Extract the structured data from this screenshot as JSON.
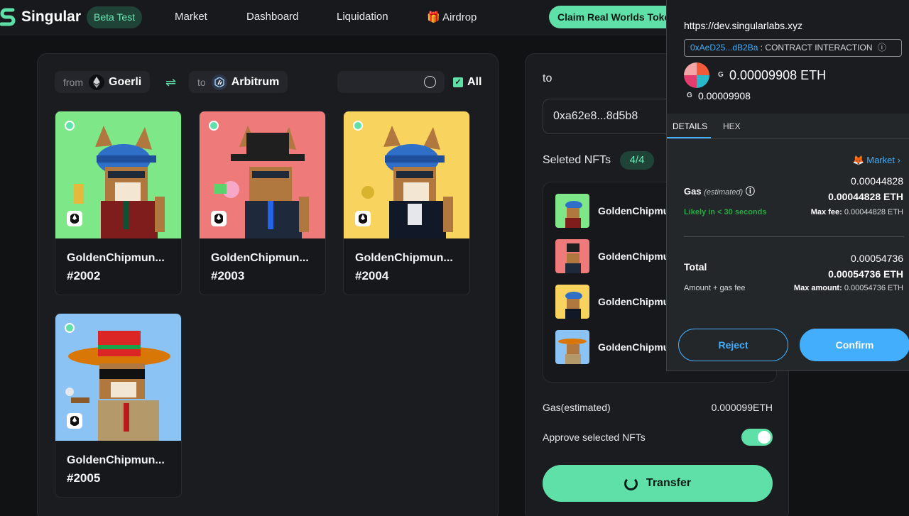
{
  "nav": {
    "brand": "Singular",
    "beta": "Beta Test",
    "links": [
      "Market",
      "Dashboard",
      "Liquidation",
      "Airdrop"
    ],
    "claim": "Claim Real Worlds Token"
  },
  "bridge": {
    "from_label": "from",
    "from_chain": "Goerli",
    "to_label": "to",
    "to_chain": "Arbitrum",
    "all_label": "All"
  },
  "nfts": [
    {
      "name": "GoldenChipmun...",
      "id": "#2002",
      "bg": "#7ee787"
    },
    {
      "name": "GoldenChipmun...",
      "id": "#2003",
      "bg": "#ef7a7a"
    },
    {
      "name": "GoldenChipmun...",
      "id": "#2004",
      "bg": "#f8d35e"
    },
    {
      "name": "GoldenChipmun...",
      "id": "#2005",
      "bg": "#8cc3f5"
    }
  ],
  "transfer": {
    "to_label": "to",
    "to_address": "0xa62e8...8d5b8",
    "selected_label": "Seleted NFTs",
    "selected_count": "4/4",
    "selected_items": [
      "GoldenChipmunk",
      "GoldenChipmunk",
      "GoldenChipmunk",
      "GoldenChipmunk"
    ],
    "gas_label": "Gas(estimated)",
    "gas_value": "0.000099ETH",
    "approve_label": "Approve selected NFTs",
    "approve_on": true,
    "button": "Transfer"
  },
  "metamask": {
    "url": "https://dev.singularlabs.xyz",
    "contract_addr": "0xAeD25...dB2Ba",
    "contract_text": ": CONTRACT INTERACTION",
    "g": "G",
    "amount": "0.00009908 ETH",
    "amount_short": "0.00009908",
    "tab_details": "DETAILS",
    "tab_hex": "HEX",
    "market": "Market",
    "gas_label": "Gas",
    "gas_est": "(estimated)",
    "gas_val": "0.00044828",
    "gas_val_eth": "0.00044828 ETH",
    "likely": "Likely in < 30 seconds",
    "max_fee_label": "Max fee:",
    "max_fee": "0.00044828 ETH",
    "total_label": "Total",
    "total_val": "0.00054736",
    "total_val_eth": "0.00054736 ETH",
    "amount_gas": "Amount + gas fee",
    "max_amount_label": "Max amount:",
    "max_amount": "0.00054736 ETH",
    "reject": "Reject",
    "confirm": "Confirm"
  }
}
